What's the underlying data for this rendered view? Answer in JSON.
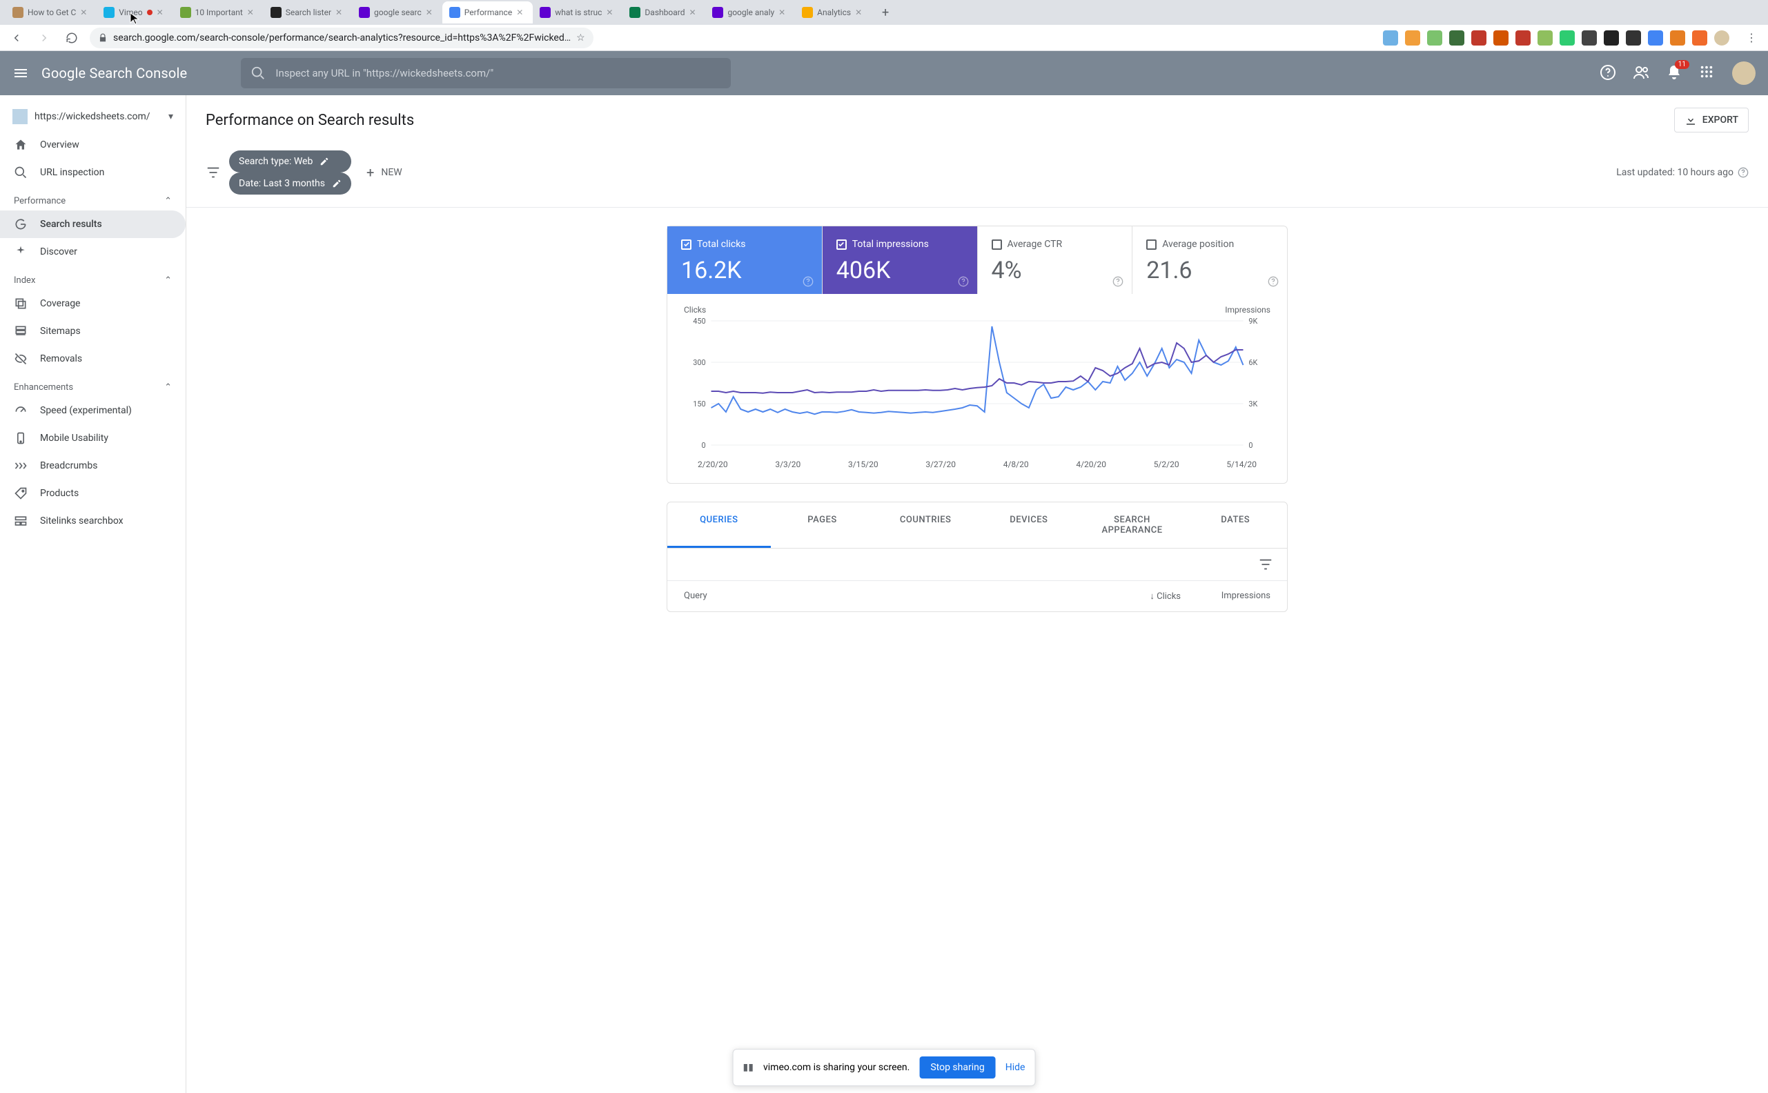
{
  "browser": {
    "tabs": [
      {
        "title": "How to Get C",
        "fav": "#b78b5a"
      },
      {
        "title": "Vimeo",
        "fav": "#17b1e7",
        "extra": "rec"
      },
      {
        "title": "10 Important",
        "fav": "#6fa43a"
      },
      {
        "title": "Search lister",
        "fav": "#222"
      },
      {
        "title": "google searc",
        "fav": "#5f01d1"
      },
      {
        "title": "Performance",
        "fav": "#4285f4",
        "active": true
      },
      {
        "title": "what is struc",
        "fav": "#5f01d1"
      },
      {
        "title": "Dashboard",
        "fav": "#0a7b4b"
      },
      {
        "title": "google analy",
        "fav": "#5f01d1"
      },
      {
        "title": "Analytics",
        "fav": "#f9ab00"
      }
    ],
    "url": "search.google.com/search-console/performance/search-analytics?resource_id=https%3A%2F%2Fwicked…",
    "ext_colors": [
      "#6fb1e4",
      "#f19e3b",
      "#7cc26d",
      "#3b6e3b",
      "#c0392b",
      "#d35400",
      "#c0392b",
      "#8fbf5e",
      "#2ecc71",
      "#444",
      "#222",
      "#333",
      "#4285f4",
      "#e67e22",
      "#f06a2b",
      "#d8c7a5"
    ]
  },
  "header": {
    "logo": "Google Search Console",
    "placeholder": "Inspect any URL in \"https://wickedsheets.com/\"",
    "notif": "11"
  },
  "sidebar": {
    "property": "https://wickedsheets.com/",
    "items_top": [
      {
        "label": "Overview",
        "icon": "home"
      },
      {
        "label": "URL inspection",
        "icon": "search"
      }
    ],
    "sec_perf": "Performance",
    "items_perf": [
      {
        "label": "Search results",
        "icon": "G",
        "active": true
      },
      {
        "label": "Discover",
        "icon": "spark"
      }
    ],
    "sec_index": "Index",
    "items_index": [
      {
        "label": "Coverage",
        "icon": "copy"
      },
      {
        "label": "Sitemaps",
        "icon": "sitemap"
      },
      {
        "label": "Removals",
        "icon": "eyeoff"
      }
    ],
    "sec_enh": "Enhancements",
    "items_enh": [
      {
        "label": "Speed (experimental)",
        "icon": "speed"
      },
      {
        "label": "Mobile Usability",
        "icon": "phone"
      },
      {
        "label": "Breadcrumbs",
        "icon": "bread"
      },
      {
        "label": "Products",
        "icon": "tag"
      },
      {
        "label": "Sitelinks searchbox",
        "icon": "sitelinks"
      }
    ]
  },
  "page": {
    "title": "Performance on Search results",
    "export": "EXPORT",
    "filters": [
      {
        "label": "Search type: Web"
      },
      {
        "label": "Date: Last 3 months"
      }
    ],
    "add_new": "NEW",
    "updated": "Last updated: 10 hours ago"
  },
  "metrics": [
    {
      "label": "Total clicks",
      "value": "16.2K",
      "cls": "blue",
      "checked": true
    },
    {
      "label": "Total impressions",
      "value": "406K",
      "cls": "purple",
      "checked": true
    },
    {
      "label": "Average CTR",
      "value": "4%",
      "cls": "off",
      "checked": false
    },
    {
      "label": "Average position",
      "value": "21.6",
      "cls": "off",
      "checked": false
    }
  ],
  "chart_data": {
    "type": "line",
    "xlabel": "",
    "left_title": "Clicks",
    "right_title": "Impressions",
    "left_ticks": [
      450,
      300,
      150,
      0
    ],
    "right_ticks": [
      "9K",
      "6K",
      "3K",
      "0"
    ],
    "x_ticks": [
      "2/20/20",
      "3/3/20",
      "3/15/20",
      "3/27/20",
      "4/8/20",
      "4/20/20",
      "5/2/20",
      "5/14/20"
    ],
    "series": [
      {
        "name": "Clicks",
        "color": "#4f86ec",
        "values": [
          135,
          150,
          120,
          175,
          130,
          120,
          130,
          120,
          130,
          118,
          130,
          120,
          115,
          120,
          112,
          120,
          120,
          118,
          122,
          128,
          120,
          118,
          116,
          118,
          122,
          120,
          118,
          116,
          118,
          120,
          118,
          122,
          126,
          130,
          135,
          145,
          142,
          120,
          430,
          300,
          190,
          170,
          150,
          135,
          200,
          220,
          170,
          175,
          210,
          200,
          210,
          230,
          200,
          230,
          225,
          285,
          235,
          260,
          300,
          250,
          295,
          350,
          280,
          310,
          300,
          260,
          380,
          325,
          300,
          290,
          305,
          355,
          290
        ]
      },
      {
        "name": "Impressions",
        "color": "#5c4bb5",
        "values": [
          195,
          195,
          190,
          195,
          190,
          190,
          190,
          188,
          192,
          190,
          190,
          190,
          195,
          200,
          190,
          192,
          190,
          192,
          192,
          192,
          195,
          195,
          200,
          195,
          198,
          198,
          198,
          198,
          198,
          200,
          198,
          198,
          200,
          205,
          200,
          205,
          208,
          210,
          215,
          240,
          225,
          225,
          218,
          230,
          228,
          225,
          225,
          230,
          230,
          232,
          250,
          230,
          280,
          270,
          250,
          260,
          280,
          295,
          350,
          280,
          295,
          300,
          290,
          370,
          350,
          300,
          305,
          325,
          300,
          320,
          330,
          345,
          345
        ]
      }
    ],
    "ylim": [
      0,
      450
    ]
  },
  "table": {
    "tabs": [
      "QUERIES",
      "PAGES",
      "COUNTRIES",
      "DEVICES",
      "SEARCH APPEARANCE",
      "DATES"
    ],
    "active_tab": 0,
    "col1": "Query",
    "col2": "Clicks",
    "col3": "Impressions"
  },
  "share": {
    "text": "vimeo.com is sharing your screen.",
    "stop": "Stop sharing",
    "hide": "Hide"
  }
}
